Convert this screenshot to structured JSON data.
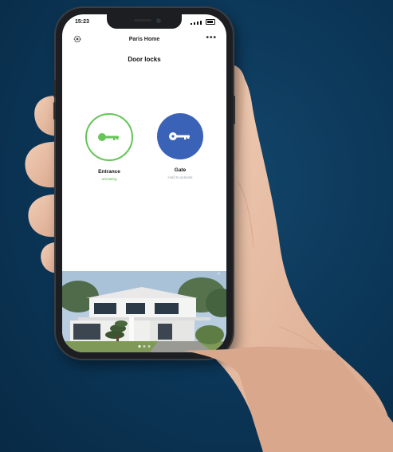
{
  "status": {
    "time": "15:23"
  },
  "header": {
    "home_name": "Paris Home",
    "settings_icon": "gear-icon",
    "more_icon": "more-icon",
    "more_glyph": "•••"
  },
  "section": {
    "title": "Door locks"
  },
  "locks": [
    {
      "name": "Entrance",
      "status": "activating",
      "icon": "key-icon",
      "ring_color": "#66c45a"
    },
    {
      "name": "Gate",
      "status": "Hold to activate",
      "icon": "key-icon",
      "fill_color": "#3a62b7"
    }
  ],
  "photo": {
    "chevron": "^"
  },
  "colors": {
    "background": "#0b3556",
    "accent_green": "#66c45a",
    "accent_blue": "#3a62b7"
  }
}
